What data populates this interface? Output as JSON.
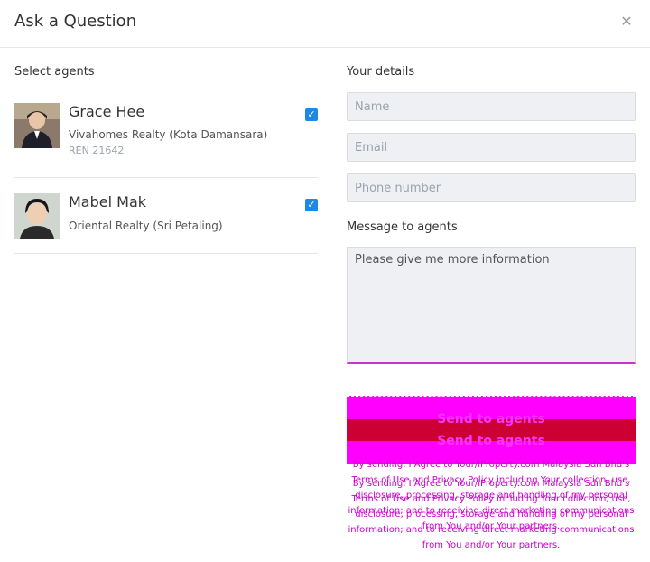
{
  "dialog": {
    "title": "Ask a Question",
    "close_icon": "close-icon"
  },
  "agents_section": {
    "label": "Select agents",
    "agents": [
      {
        "name": "Grace Hee",
        "agency": "Vivahomes Realty (Kota Damansara)",
        "ren": "REN 21642",
        "checked": true
      },
      {
        "name": "Mabel Mak",
        "agency": "Oriental Realty (Sri Petaling)",
        "ren": "",
        "checked": true
      }
    ]
  },
  "details": {
    "label": "Your details",
    "name_placeholder": "Name",
    "email_placeholder": "Email",
    "phone_placeholder": "Phone number",
    "message_label": "Message to agents",
    "message_value": "Please give me more information"
  },
  "send": {
    "label": "Send to agents"
  },
  "legal": {
    "text": "By sending, I Agree to Your/iProperty.com Malaysia Sdn Bhd's Terms of Use and Privacy Policy including Your collection, use, disclosure, processing, storage and handling of my personal information; and to receiving direct marketing communications from You and/or Your partners."
  },
  "colors": {
    "accent": "#1e88e5",
    "send_magenta": "#ff00ff",
    "send_red": "#cc0033"
  }
}
